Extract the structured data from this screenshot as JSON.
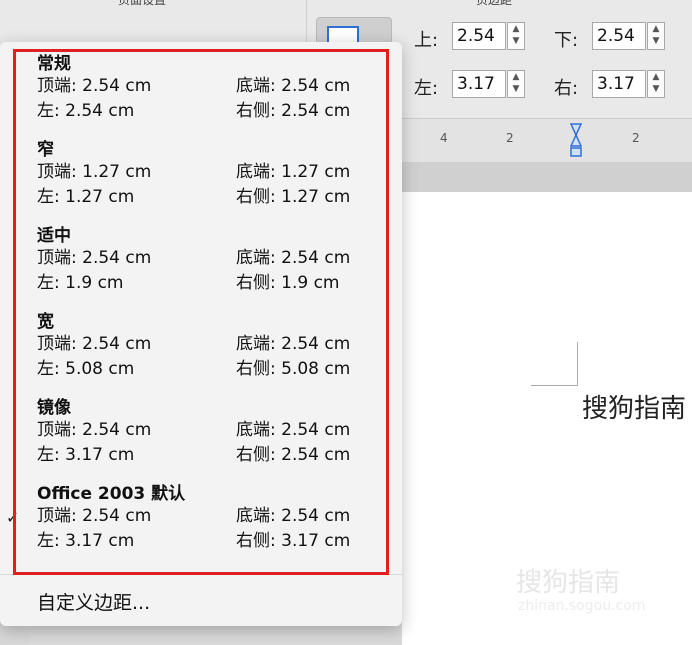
{
  "ribbon": {
    "page_setup_title": "页面设置",
    "margins_title": "页边距",
    "top_label": "上:",
    "top_value": "2.54",
    "bottom_label": "下:",
    "bottom_value": "2.54",
    "left_label": "左:",
    "left_value": "3.17",
    "right_label": "右:",
    "right_value": "3.17"
  },
  "ruler": {
    "ticks": [
      "4",
      "2",
      "2"
    ]
  },
  "document": {
    "text": "搜狗指南",
    "watermark": "搜狗指南",
    "watermark_url": "zhinan.sogou.com"
  },
  "presets": [
    {
      "name": "常规",
      "top": "顶端: 2.54 cm",
      "bottom": "底端: 2.54 cm",
      "left": "左:   2.54 cm",
      "right": "右侧: 2.54 cm"
    },
    {
      "name": "窄",
      "top": "顶端: 1.27 cm",
      "bottom": "底端: 1.27 cm",
      "left": "左:   1.27 cm",
      "right": "右侧: 1.27 cm"
    },
    {
      "name": "适中",
      "top": "顶端: 2.54 cm",
      "bottom": "底端: 2.54 cm",
      "left": "左:   1.9 cm",
      "right": "右侧: 1.9 cm"
    },
    {
      "name": "宽",
      "top": "顶端: 2.54 cm",
      "bottom": "底端: 2.54 cm",
      "left": "左:   5.08 cm",
      "right": "右侧: 5.08 cm"
    },
    {
      "name": "镜像",
      "top": "顶端: 2.54 cm",
      "bottom": "底端: 2.54 cm",
      "left": "左:   3.17 cm",
      "right": "右侧: 2.54 cm"
    },
    {
      "name": "Office 2003 默认",
      "top": "顶端: 2.54 cm",
      "bottom": "底端: 2.54 cm",
      "left": "左:   3.17 cm",
      "right": "右侧: 3.17 cm"
    }
  ],
  "checkmark": "✓",
  "custom_margins": "自定义边距..."
}
